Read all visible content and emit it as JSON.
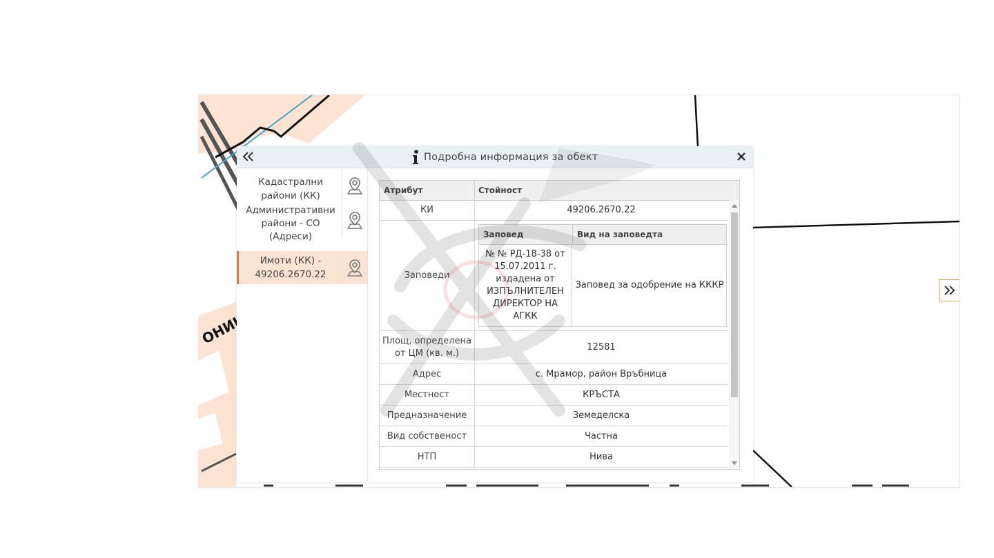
{
  "panel": {
    "title": "Подробна информация за обект",
    "collapse_icon": "double-chevron-left-icon",
    "info_icon": "info-icon",
    "close_icon": "close-icon"
  },
  "layers": [
    {
      "label": "Кадастрални райони (КК)",
      "icon": "map-pin-icon",
      "active": false
    },
    {
      "label": "Административни райони - СО (Адреси)",
      "icon": "map-pin-icon",
      "active": true
    },
    {
      "label": "Имоти (КК) - 49206.2670.22",
      "icon": "map-pin-icon",
      "active": true
    }
  ],
  "table": {
    "headers": [
      "Атрибут",
      "Стойност"
    ],
    "rows": [
      {
        "key": "КИ",
        "value": "49206.2670.22"
      },
      {
        "key": "Заповеди",
        "value": null
      },
      {
        "key": "Площ, определена от ЦМ (кв. м.)",
        "value": "12581"
      },
      {
        "key": "Адрес",
        "value": "с. Мрамор, район Връбница"
      },
      {
        "key": "Местност",
        "value": "КРЪСТА"
      },
      {
        "key": "Предназначение",
        "value": "Земеделска"
      },
      {
        "key": "Вид собственост",
        "value": "Частна"
      },
      {
        "key": "НТП",
        "value": "Нива"
      }
    ],
    "orders": {
      "headers": [
        "Заповед",
        "Вид на заповедта"
      ],
      "rows": [
        {
          "order": "№ № РД-18-38 от 15.07.2011 г. издадена от ИЗПЪЛНИТЕЛЕН ДИРЕКТОР НА АГКК",
          "type": "Заповед за одобрение на КККР"
        }
      ]
    }
  },
  "map": {
    "street_label": "ОНИЦ",
    "expand_icon": "double-chevron-right-icon",
    "colors": {
      "parcel_fill": "#fde3d2",
      "boundary": "#111111",
      "water_line": "#4aa3c8"
    }
  }
}
